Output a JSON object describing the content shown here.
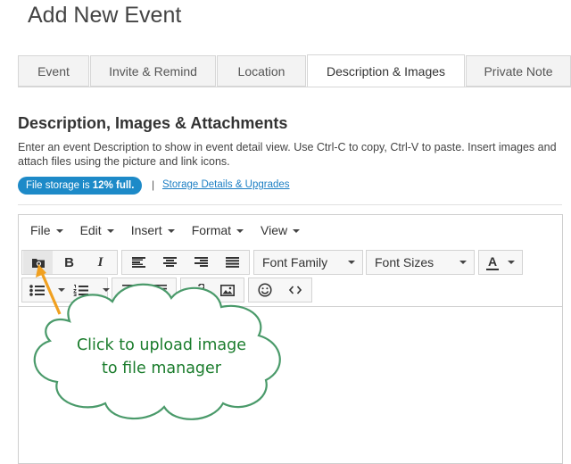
{
  "page": {
    "title": "Add New Event"
  },
  "tabs": [
    {
      "label": "Event"
    },
    {
      "label": "Invite & Remind"
    },
    {
      "label": "Location"
    },
    {
      "label": "Description & Images",
      "active": true
    },
    {
      "label": "Private Note"
    }
  ],
  "section": {
    "title": "Description, Images & Attachments",
    "description": "Enter an event Description to show in event detail view. Use Ctrl-C to copy, Ctrl-V to paste. Insert images and attach files using the picture and link icons."
  },
  "storage": {
    "badge_prefix": "File storage is ",
    "badge_percent": "12% full.",
    "separator": "|",
    "link": "Storage Details & Upgrades"
  },
  "editor": {
    "menu": [
      "File",
      "Edit",
      "Insert",
      "Format",
      "View"
    ],
    "font_family_label": "Font Family",
    "font_sizes_label": "Font Sizes",
    "bold_label": "B",
    "italic_label": "I",
    "text_color_label": "A"
  },
  "callout": {
    "line1": "Click to upload image",
    "line2": "to file manager",
    "arrow_color": "#f0a020",
    "text_color": "#1a7c2c",
    "border_color": "#4a9a6a"
  },
  "colors": {
    "badge": "#1d8ac8",
    "link": "#1d7fc4"
  }
}
